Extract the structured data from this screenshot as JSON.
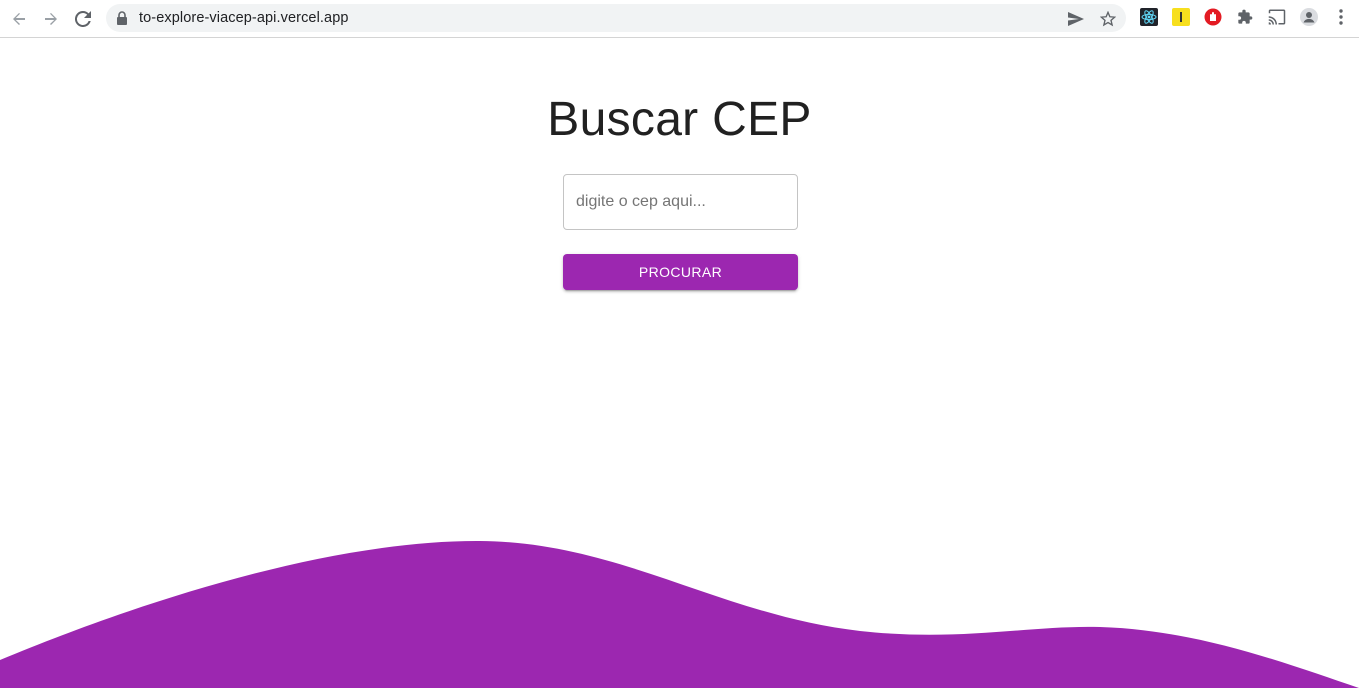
{
  "browser": {
    "url": "to-explore-viacep-api.vercel.app",
    "icons": {
      "back": "back-arrow-icon",
      "forward": "forward-arrow-icon",
      "reload": "reload-icon",
      "lock": "lock-icon",
      "send": "send-icon",
      "bookmark": "star-icon",
      "extensions": [
        "react-devtools-icon",
        "yellow-extension-icon",
        "red-hand-extension-icon",
        "puzzle-icon",
        "cast-icon",
        "profile-icon",
        "menu-dots-icon"
      ]
    }
  },
  "page": {
    "title": "Buscar CEP",
    "input": {
      "placeholder": "digite o cep aqui...",
      "value": ""
    },
    "button_label": "PROCURAR"
  },
  "colors": {
    "accent": "#9c27b0",
    "title_text": "#212121"
  }
}
